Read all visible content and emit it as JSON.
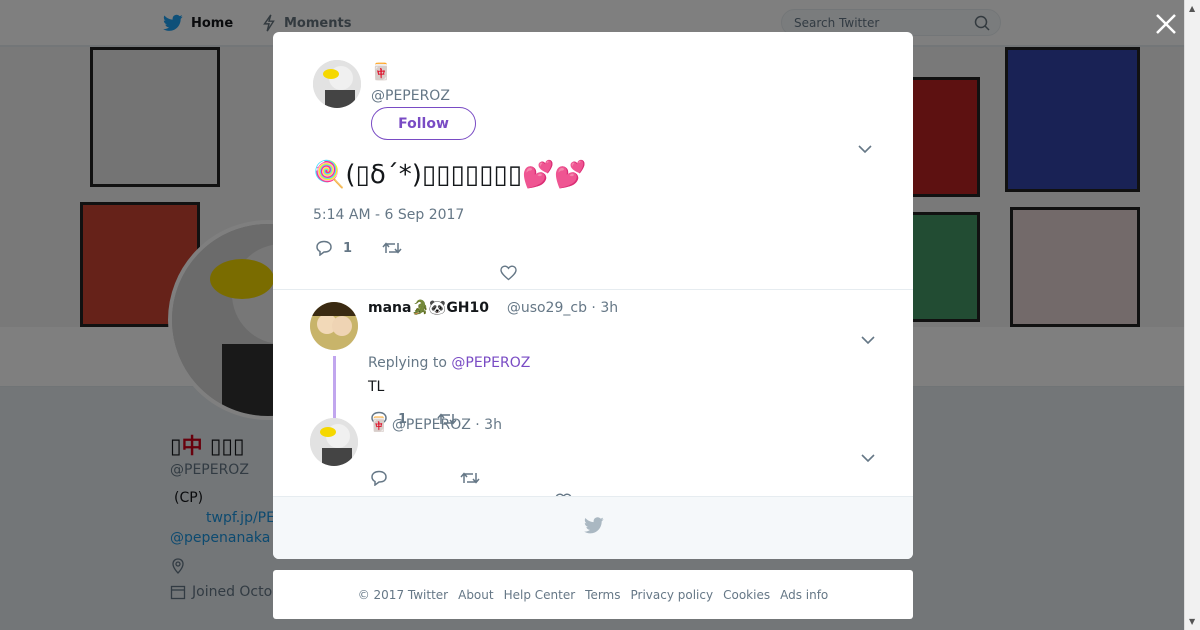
{
  "nav": {
    "home_label": "Home",
    "moments_label": "Moments",
    "search_placeholder": "Search Twitter"
  },
  "profile": {
    "display_name_prefix": "▯",
    "display_name_mahjong": "中",
    "display_name_suffix": " ▯▯▯",
    "handle": "@PEPEROZ",
    "bio": "(CP)",
    "link": "twpf.jp/PE",
    "mention": "@pepenanaka",
    "joined": "Joined Octo"
  },
  "main_tweet": {
    "author_name": "🀄",
    "author_handle": "@PEPEROZ",
    "follow_label": "Follow",
    "text": "🍭(▯δ´*)▯▯▯▯▯▯▯💕💕",
    "timestamp": "5:14 AM - 6 Sep 2017",
    "reply_count": "1"
  },
  "replies": [
    {
      "author_name": "mana🐊🐼GH10",
      "author_handle": "@uso29_cb",
      "time": "· 3h",
      "replying_prefix": "Replying to",
      "replying_to": "@PEPEROZ",
      "text": "TL",
      "reply_count": "1"
    },
    {
      "author_name": "🀄",
      "author_handle": "@PEPEROZ",
      "time": "· 3h",
      "text": "",
      "reply_count": ""
    }
  ],
  "footer": {
    "copyright": "© 2017 Twitter",
    "links": [
      "About",
      "Help Center",
      "Terms",
      "Privacy policy",
      "Cookies",
      "Ads info"
    ]
  },
  "colors": {
    "accent": "#794bc4",
    "link": "#1b95e0",
    "muted": "#657786",
    "thread_line": "#c1a6ee"
  }
}
